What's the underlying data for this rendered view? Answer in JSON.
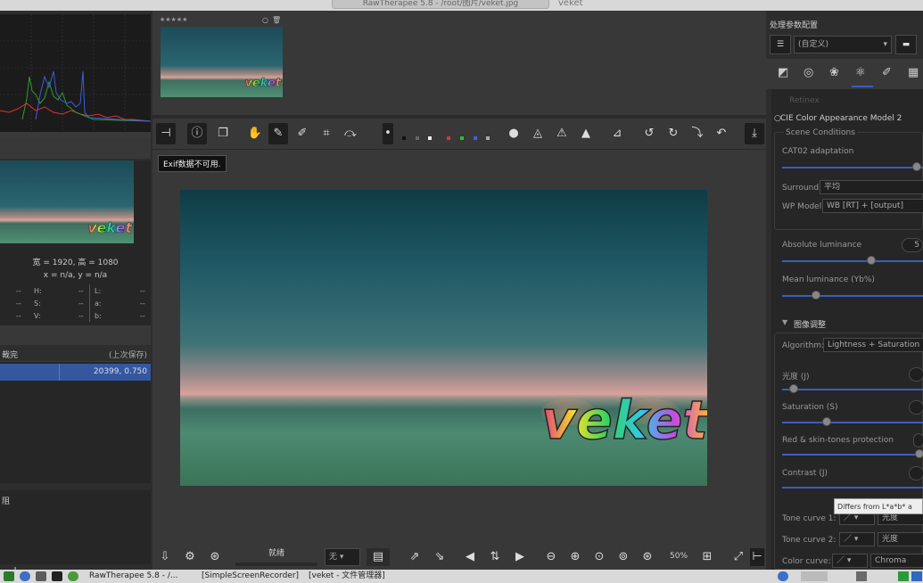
{
  "window": {
    "title": "RawTherapee 5.8 - /root/图片/veket.jpg",
    "tab_title": "veket"
  },
  "photo": {
    "watermark": "veket",
    "exif_badge": "Exif数据不可用."
  },
  "filmstrip": {
    "rating_stars": "★★★★★",
    "thumb_watermark": "veket"
  },
  "navigator": {
    "thumb_watermark": "veket",
    "dimensions": "宽 = 1920, 高 = 1080",
    "coords": "x = n/a, y = n/a",
    "rows": [
      {
        "a": "--",
        "b": "H:",
        "c": "--",
        "d": "L:",
        "e": "--"
      },
      {
        "a": "--",
        "b": "S:",
        "c": "--",
        "d": "a:",
        "e": "--"
      },
      {
        "a": "--",
        "b": "V:",
        "c": "--",
        "d": "b:",
        "e": "--"
      }
    ]
  },
  "history": {
    "col1": "裁完",
    "col2": "(上次保存)",
    "row_value": "20399, 0.750"
  },
  "snapshot": {
    "label": "阻"
  },
  "left_bottom": {
    "add": "+",
    "remove": "−"
  },
  "bottom": {
    "status": "就绪",
    "none_select": "无",
    "zoom": "50%"
  },
  "right": {
    "header": "处理参数配置",
    "profile": "(自定义)",
    "retinex": "Retinex",
    "ciecam": "CIE Color Appearance Model 2",
    "scene": "Scene Conditions",
    "cat02": "CAT02 adaptation",
    "surround_label": "Surround:",
    "surround_value": "平均",
    "wp_label": "WP Model:",
    "wp_value": "WB [RT] + [output]",
    "abs_lum": "Absolute luminance",
    "abs_lum_value": "5",
    "mean_lum": "Mean luminance (Yb%)",
    "image_adj": "图像调整",
    "algo_label": "Algorithm:",
    "algo_value": "Lightness + Saturation",
    "lightness": "光度 (J)",
    "saturation": "Saturation (S)",
    "red_skin": "Red & skin-tones protection",
    "contrast": "Contrast (J)",
    "tooltip": "Differs from L*a*b* a",
    "tone1": "Tone curve 1:",
    "tone1_val": "光度",
    "tone2": "Tone curve 2:",
    "tone2_val": "光度",
    "color_curve": "Color curve:",
    "color_curve_val": "Chroma"
  },
  "taskbar": {
    "rt": "RawTherapee 5.8 - /...",
    "ssr": "[SimpleScreenRecorder]",
    "fm": "[veket - 文件管理器]"
  },
  "colors": {
    "accent": "#3457a0",
    "slider": "#3b5ebc"
  }
}
